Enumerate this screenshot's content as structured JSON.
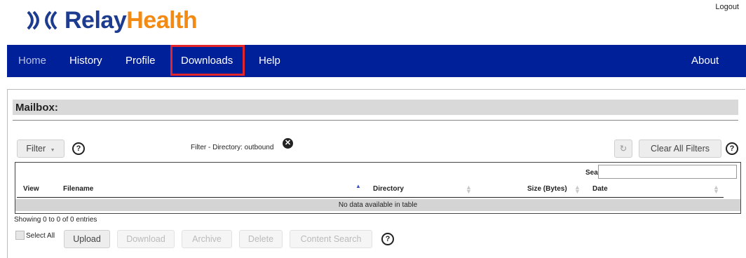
{
  "header": {
    "logo_part1": "Relay",
    "logo_part2": "Health",
    "logout_label": "Logout"
  },
  "nav": {
    "home": "Home",
    "history": "History",
    "profile": "Profile",
    "downloads": "Downloads",
    "help": "Help",
    "about": "About",
    "highlighted": "Downloads"
  },
  "mailbox": {
    "title": "Mailbox:",
    "filter_button": "Filter",
    "filter_status": "Filter - Directory: outbound",
    "clear_all_filters": "Clear All Filters",
    "search_label": "Search:",
    "search_value": "",
    "columns": [
      "View",
      "Filename",
      "Directory",
      "Size (Bytes)",
      "Date"
    ],
    "empty_message": "No data available in table",
    "showing": "Showing 0 to 0 of 0 entries",
    "select_all": "Select All",
    "actions": {
      "upload": "Upload",
      "download": "Download",
      "archive": "Archive",
      "delete": "Delete",
      "content_search": "Content Search"
    },
    "help_glyph": "?",
    "refresh_glyph": "↻",
    "caret_glyph": "▼",
    "clear_glyph": "✕"
  },
  "colors": {
    "navbar": "#00209a",
    "highlight_border": "#e2262b",
    "logo_blue": "#1d3c8f",
    "logo_orange": "#f28a13"
  }
}
